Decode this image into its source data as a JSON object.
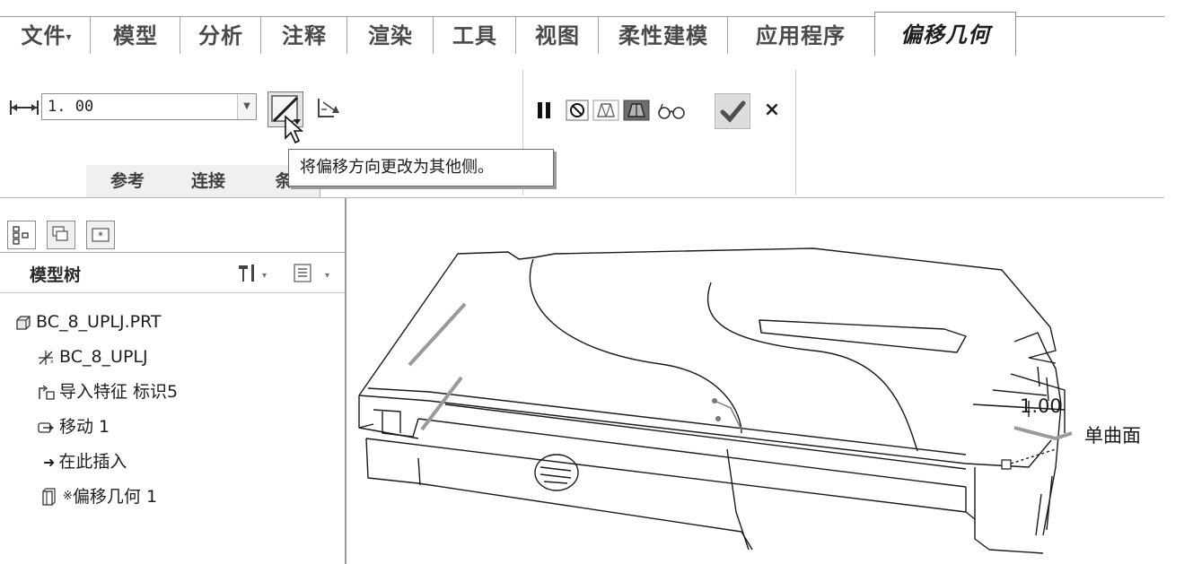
{
  "ribbon_tabs": [
    {
      "label": "文件",
      "has_dropdown": true
    },
    {
      "label": "模型"
    },
    {
      "label": "分析"
    },
    {
      "label": "注释"
    },
    {
      "label": "渲染"
    },
    {
      "label": "工具"
    },
    {
      "label": "视图"
    },
    {
      "label": "柔性建模"
    },
    {
      "label": "应用程序"
    },
    {
      "label": "偏移几何",
      "active": true
    }
  ],
  "offset": {
    "value": "1. 00",
    "dim_icon": "offset-distance-icon",
    "flip_icon": "flip-direction-icon",
    "side_icon": "side-select-icon"
  },
  "controls": {
    "pause_icon": "pause-icon",
    "no_preview_icon": "no-preview-icon",
    "geometry_preview_icon": "geometry-preview-icon",
    "feature_preview_icon": "feature-preview-icon",
    "verify_icon": "glasses-icon",
    "ok_icon": "checkmark-icon",
    "cancel_label": "×"
  },
  "subtabs": [
    "参考",
    "连接",
    "条"
  ],
  "tooltip": "将偏移方向更改为其他侧。",
  "panel_tabs": [
    "model-tree-tab-icon",
    "layer-tree-tab-icon",
    "favorites-tab-icon"
  ],
  "tree": {
    "title": "模型树",
    "items": [
      {
        "label": "BC_8_UPLJ.PRT",
        "icon": "part-icon"
      },
      {
        "label": "BC_8_UPLJ",
        "icon": "coordinate-system-icon"
      },
      {
        "label": "导入特征 标识5",
        "icon": "import-feature-icon"
      },
      {
        "label": "移动 1",
        "icon": "move-icon"
      },
      {
        "label": "在此插入",
        "icon": "insert-here-arrow-icon"
      },
      {
        "label": "偏移几何 1",
        "icon": "offset-geometry-icon",
        "prefix": "※"
      }
    ]
  },
  "viewport": {
    "dimension_value": "1.00",
    "surface_label": "单曲面"
  },
  "colors": {
    "highlight_gray": "#9a9a9a",
    "ok_green": "#2f8f2f"
  }
}
